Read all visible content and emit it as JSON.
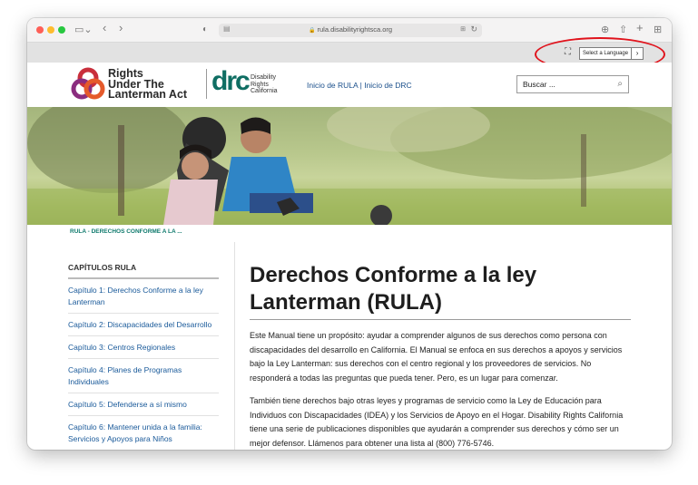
{
  "browser": {
    "url": "rula.disabilityrightsca.org"
  },
  "language_bar": {
    "select_label": "Select a Language"
  },
  "header": {
    "logo_line1": "Rights",
    "logo_line2": "Under The",
    "logo_line3": "Lanterman Act",
    "drc_letters": "drc",
    "drc_line1": "Disability",
    "drc_line2": "Rights",
    "drc_line3": "California",
    "nav_rula": "Inicio de RULA",
    "nav_sep": "|",
    "nav_drc": "Inicio de DRC",
    "search_placeholder": "Buscar ..."
  },
  "breadcrumb": "RULA - DERECHOS CONFORME A LA ...",
  "sidebar": {
    "title": "CAPÍTULOS RULA",
    "items": [
      {
        "label": "Capítulo 1: Derechos Conforme a la ley Lanterman"
      },
      {
        "label": "Capítulo 2: Discapacidades del Desarrollo"
      },
      {
        "label": "Capítulo 3: Centros Regionales"
      },
      {
        "label": "Capítulo 4: Planes de Programas Individuales"
      },
      {
        "label": "Capítulo 5: Defenderse a sí mismo"
      },
      {
        "label": "Capítulo 6: Mantener unida a la familia: Servicios y Apoyos para Niños"
      }
    ]
  },
  "main": {
    "title": "Derechos Conforme a la ley Lanterman (RULA)",
    "para1": "Este Manual tiene un propósito: ayudar a comprender algunos de sus derechos como persona con discapacidades del desarrollo en California. El Manual se enfoca en sus derechos a apoyos y servicios bajo la Ley Lanterman: sus derechos con el centro regional y los proveedores de servicios. No responderá a todas las preguntas que pueda tener. Pero, es un lugar para comenzar.",
    "para2": "También tiene derechos bajo otras leyes y programas de servicio como la Ley de Educación para Individuos con Discapacidades (IDEA) y los Servicios de Apoyo en el Hogar. Disability Rights California tiene una serie de publicaciones disponibles que ayudarán a comprender sus derechos y cómo ser un mejor defensor. Llámenos para obtener una lista al (800) 776-5746."
  },
  "colors": {
    "annotation": "#e0131c",
    "drc_green": "#0f6e63",
    "link_blue": "#1a5a9a"
  },
  "icons": [
    "sidebar-toggle-icon",
    "back-icon",
    "forward-icon",
    "shield-icon",
    "lock-icon",
    "translate-icon",
    "reload-icon",
    "download-icon",
    "share-icon",
    "new-tab-icon",
    "tab-overview-icon",
    "search-icon"
  ]
}
